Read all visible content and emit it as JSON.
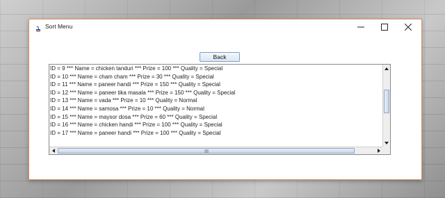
{
  "window": {
    "title": "Sort Menu"
  },
  "buttons": {
    "back_label": "Back"
  },
  "list": {
    "rows": [
      "ID =  9  *** Name = chicken tanduri *** Prize = 100 *** Quality = Special",
      "ID =  10  *** Name = cham cham *** Prize = 30 *** Quality = Special",
      "ID =  11  *** Name = paneer handi *** Prize = 150 *** Quality = Special",
      "ID =  12  *** Name = paneer tika masala *** Prize = 150 *** Quality = Special",
      "ID =  13  *** Name = vada *** Prize = 10 *** Quality = Normal",
      "ID =  14  *** Name = samosa *** Prize = 10 *** Quality = Normal",
      "ID =  15  *** Name = maysor dosa *** Prize = 60 *** Quality = Special",
      "ID =  16  *** Name = chicken handi *** Prize = 100 *** Quality = Special",
      "ID =  17  *** Name = paneer handi *** Prize = 100 *** Quality = Special"
    ]
  },
  "icons": {
    "app": "java-app-icon",
    "minimize": "minimize-icon",
    "maximize": "maximize-icon",
    "close": "close-icon",
    "scroll_up": "arrow-up-icon",
    "scroll_down": "arrow-down-icon",
    "scroll_left": "arrow-left-icon",
    "scroll_right": "arrow-right-icon"
  },
  "colors": {
    "window_border": "#e0905e",
    "scroll_thumb": "#c9d6e6"
  }
}
